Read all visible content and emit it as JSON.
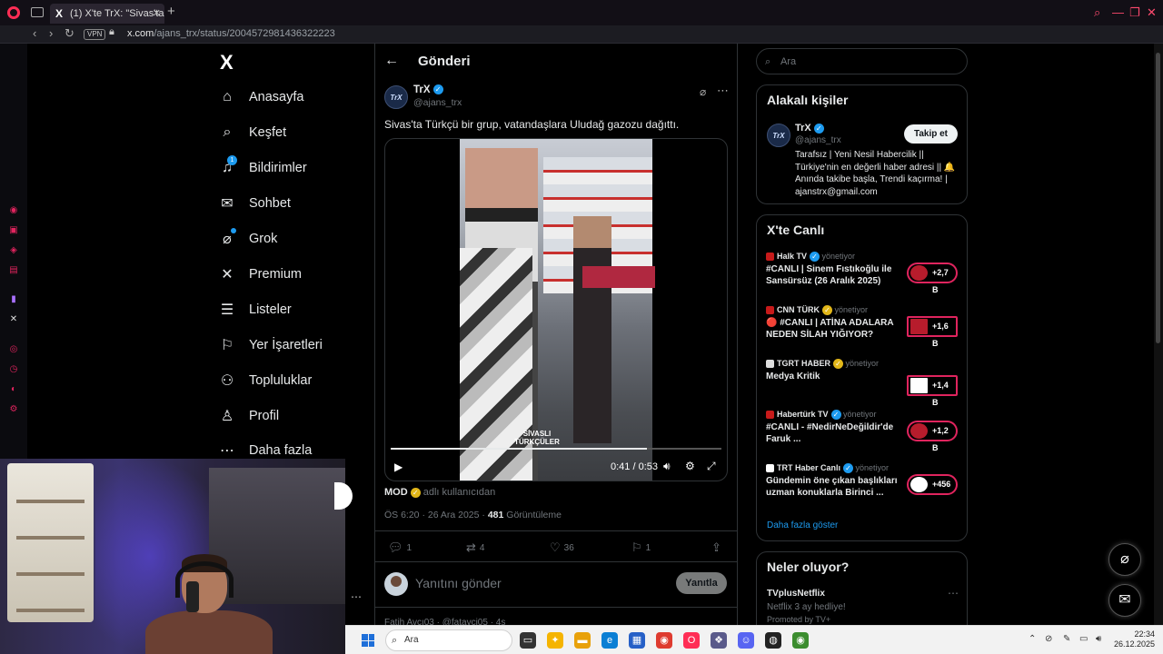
{
  "browser": {
    "tab_title": "(1) X'te TrX: \"Sivas'ta Türkç",
    "tab_x": "X",
    "tab_close": "✕",
    "new_tab": "+",
    "vpn_label": "VPN",
    "url_host": "x.com",
    "url_path": "/ajans_trx/status/2004572981436322223"
  },
  "nav": {
    "logo": "X",
    "items": [
      {
        "label": "Anasayfa",
        "icon": "home-icon"
      },
      {
        "label": "Keşfet",
        "icon": "search-icon"
      },
      {
        "label": "Bildirimler",
        "icon": "bell-icon",
        "badge": "1"
      },
      {
        "label": "Sohbet",
        "icon": "mail-icon"
      },
      {
        "label": "Grok",
        "icon": "grok-icon"
      },
      {
        "label": "Premium",
        "icon": "x-icon"
      },
      {
        "label": "Listeler",
        "icon": "list-icon"
      },
      {
        "label": "Yer İşaretleri",
        "icon": "bookmark-icon"
      },
      {
        "label": "Topluluklar",
        "icon": "people-icon"
      },
      {
        "label": "Profil",
        "icon": "user-icon"
      },
      {
        "label": "Daha fazla",
        "icon": "more-circle-icon"
      }
    ]
  },
  "post": {
    "page_title": "Gönderi",
    "author_name": "TrX",
    "author_handle": "@ajans_trx",
    "avatar_text": "TrX",
    "text": "Sivas'ta Türkçü bir grup, vatandaşlara Uludağ gazozu dağıttı.",
    "video": {
      "current_time": "0:41",
      "duration": "0:53",
      "progress": 0.774,
      "watermark": "SİVASLI TÜRKÇÜLER"
    },
    "from_user": "MOD",
    "from_user_rest": "adlı kullanıcıdan",
    "timestamp": "ÖS 6:20 · 26 Ara 2025 · ",
    "views_count": "481",
    "views_label": " Görüntüleme",
    "actions": {
      "replies": "1",
      "reposts": "4",
      "likes": "36",
      "bookmarks": "1"
    },
    "reply_placeholder": "Yanıtını gönder",
    "reply_button": "Yanıtla",
    "next_tweet": "Fatih Avcı03 · @fatavci05 · 4s"
  },
  "right": {
    "search_placeholder": "Ara",
    "related": {
      "title": "Alakalı kişiler",
      "name": "TrX",
      "handle": "@ajans_trx",
      "follow": "Takip et",
      "bio": "Tarafsız | Yeni Nesil Habercilik || Türkiye'nin en değerli haber adresi || 🔔 Anında takibe başla, Trendi kaçırma! | ajanstrx@gmail.com"
    },
    "live": {
      "title": "X'te Canlı",
      "manages": "yönetiyor",
      "items": [
        {
          "host": "Halk TV",
          "title": "#CANLI | Sinem Fıstıkoğlu ile Sansürsüz (26 Aralık 2025)",
          "count": "+2,7 B"
        },
        {
          "host": "CNN TÜRK",
          "title": "🔴 #CANLI | ATİNA ADALARA NEDEN SİLAH YIĞIYOR?",
          "count": "+1,6 B"
        },
        {
          "host": "TGRT HABER",
          "title": "Medya Kritik",
          "count": "+1,4 B"
        },
        {
          "host": "Habertürk TV",
          "title": "#CANLI - #NedirNeDeğildir'de Faruk ...",
          "count": "+1,2 B"
        },
        {
          "host": "TRT Haber Canlı",
          "title": "Gündemin öne çıkan başlıkları uzman konuklarla Birinci ...",
          "count": "+456"
        }
      ],
      "show_more": "Daha fazla göster"
    },
    "trends": {
      "title": "Neler oluyor?",
      "topic": "TVplusNetflix",
      "subtitle": "Netflix 3 ay hedliye!",
      "promoted": "Promoted by TV+"
    }
  },
  "taskbar": {
    "search_placeholder": "Ara",
    "time": "22:34",
    "date": "26.12.2025"
  },
  "colors": {
    "accent": "#1d9bf0",
    "live": "#e0245e",
    "opera": "#ff2d55"
  }
}
